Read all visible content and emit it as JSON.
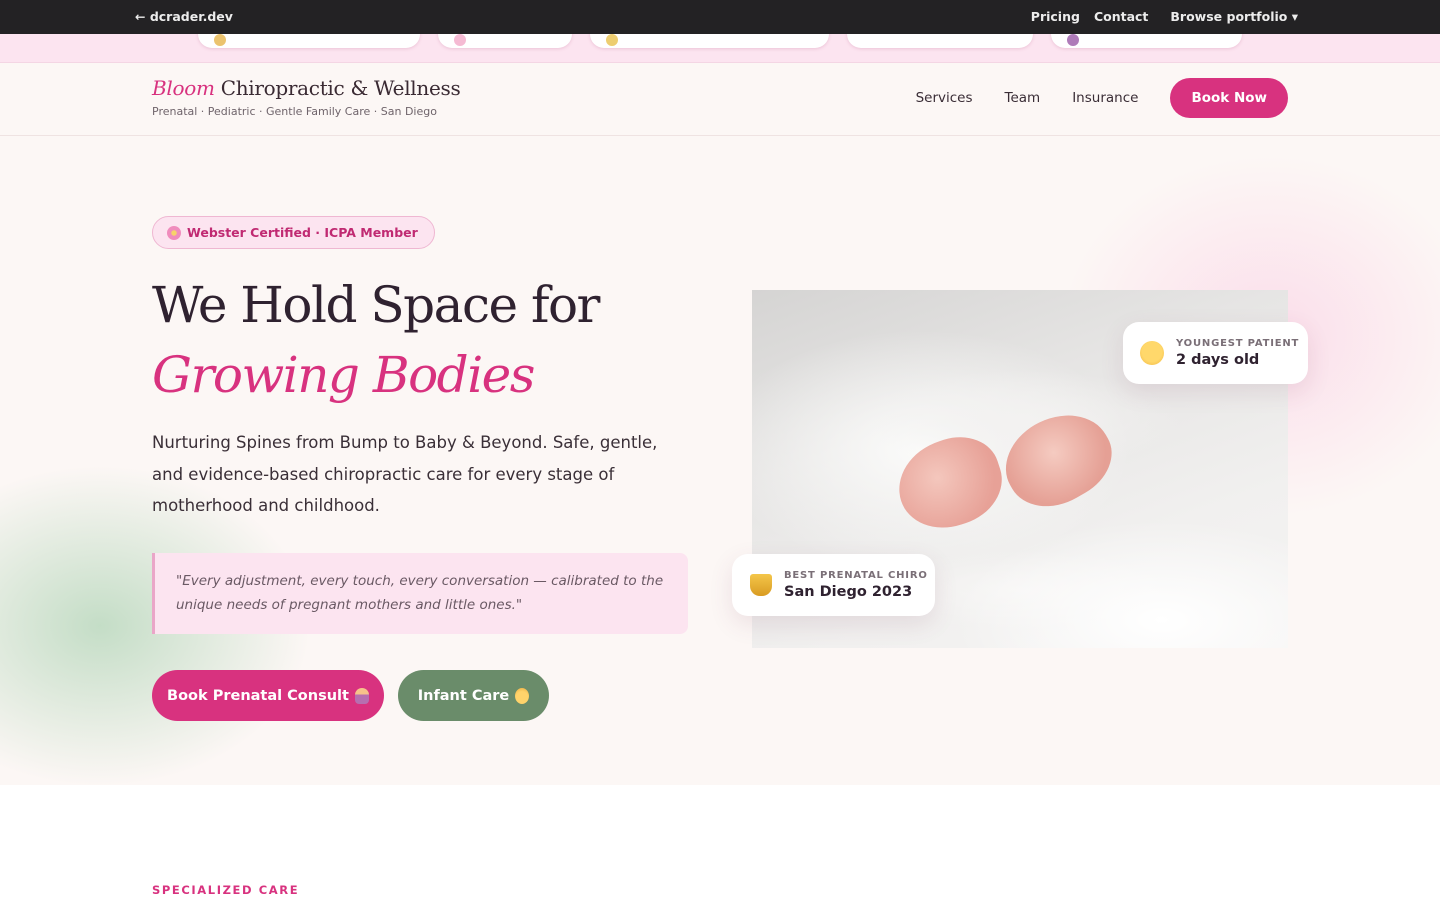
{
  "topbar": {
    "back_link": "← dcrader.dev",
    "pricing": "Pricing",
    "contact": "Contact",
    "browse": "Browse portfolio ▾"
  },
  "header": {
    "brand_accent": "Bloom",
    "brand_rest": "Chiropractic & Wellness",
    "tagline": "Prenatal · Pediatric · Gentle Family Care · San Diego",
    "nav": [
      "Services",
      "Team",
      "Insurance"
    ],
    "cta": "Book Now"
  },
  "hero": {
    "badge": "Webster Certified · ICPA Member",
    "title_line1": "We Hold Space for",
    "title_line2": "Growing Bodies",
    "lead": "Nurturing Spines from Bump to Baby & Beyond. Safe, gentle, and evidence-based chiropractic care for every stage of motherhood and childhood.",
    "quote": "\"Every adjustment, every touch, every conversation — calibrated to the unique needs of pregnant mothers and little ones.\"",
    "cta_primary": "Book Prenatal Consult",
    "cta_secondary": "Infant Care",
    "stats": [
      {
        "label": "YOUNGEST PATIENT",
        "value": "2 days old",
        "icon": "baby-face-icon"
      },
      {
        "label": "BEST PRENATAL CHIRO",
        "value": "San Diego 2023",
        "icon": "trophy-icon"
      }
    ]
  },
  "section": {
    "eyebrow": "SPECIALIZED CARE"
  },
  "colors": {
    "accent_pink": "#d8327f",
    "sage_green": "#6a8c6a",
    "hero_bg": "#fcf7f5",
    "ribbon_pink": "#fce4f0",
    "topbar_dark": "#232224"
  }
}
